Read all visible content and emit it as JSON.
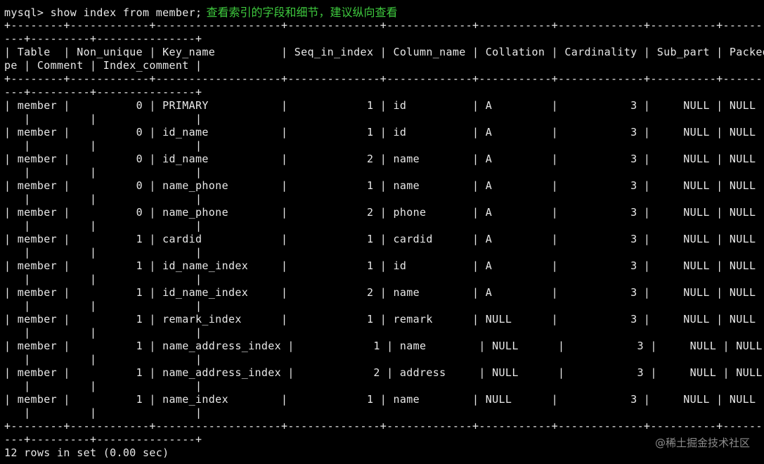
{
  "colors": {
    "background": "#000000",
    "terminal_text": "#e8e8e8",
    "annotation_text": "#3ec93e",
    "watermark_text": "#8c8c8c"
  },
  "terminal": {
    "prompt": "mysql> show index from member;",
    "annotation": "查看索引的字段和细节，建议纵向查看",
    "border": "+--------+------------+-------------------+--------------+-------------+-----------+-------------+----------+--------+-",
    "border_wrap": "---+---------+---------------+",
    "header": "| Table  | Non_unique | Key_name          | Seq_in_index | Column_name | Collation | Cardinality | Sub_part | Packed | ",
    "header_wrap": "pe | Comment | Index_comment |",
    "rows": [
      {
        "text": "| member |          0 | PRIMARY           |            1 | id          | A         |           3 |     NULL | NULL   | ",
        "wrap": "   |         |               |"
      },
      {
        "text": "| member |          0 | id_name           |            1 | id          | A         |           3 |     NULL | NULL   | ",
        "wrap": "   |         |               |"
      },
      {
        "text": "| member |          0 | id_name           |            2 | name        | A         |           3 |     NULL | NULL   | ",
        "wrap": "   |         |               |"
      },
      {
        "text": "| member |          0 | name_phone        |            1 | name        | A         |           3 |     NULL | NULL   | ",
        "wrap": "   |         |               |"
      },
      {
        "text": "| member |          0 | name_phone        |            2 | phone       | A         |           3 |     NULL | NULL   | ",
        "wrap": "   |         |               |"
      },
      {
        "text": "| member |          1 | cardid            |            1 | cardid      | A         |           3 |     NULL | NULL   | ",
        "wrap": "   |         |               |"
      },
      {
        "text": "| member |          1 | id_name_index     |            1 | id          | A         |           3 |     NULL | NULL   | ",
        "wrap": "   |         |               |"
      },
      {
        "text": "| member |          1 | id_name_index     |            2 | name        | A         |           3 |     NULL | NULL   | ",
        "wrap": "   |         |               |"
      },
      {
        "text": "| member |          1 | remark_index      |            1 | remark      | NULL      |           3 |     NULL | NULL   | ",
        "wrap": "   |         |               |"
      },
      {
        "text": "| member |          1 | name_address_index |            1 | name        | NULL      |           3 |     NULL | NULL   | ",
        "wrap": "   |         |               |"
      },
      {
        "text": "| member |          1 | name_address_index |            2 | address     | NULL      |           3 |     NULL | NULL   | ",
        "wrap": "   |         |               |"
      },
      {
        "text": "| member |          1 | name_index        |            1 | name        | NULL      |           3 |     NULL | NULL   | ",
        "wrap": "   |         |               |"
      }
    ],
    "result": "12 rows in set (0.00 sec)"
  },
  "watermark": "@稀土掘金技术社区"
}
